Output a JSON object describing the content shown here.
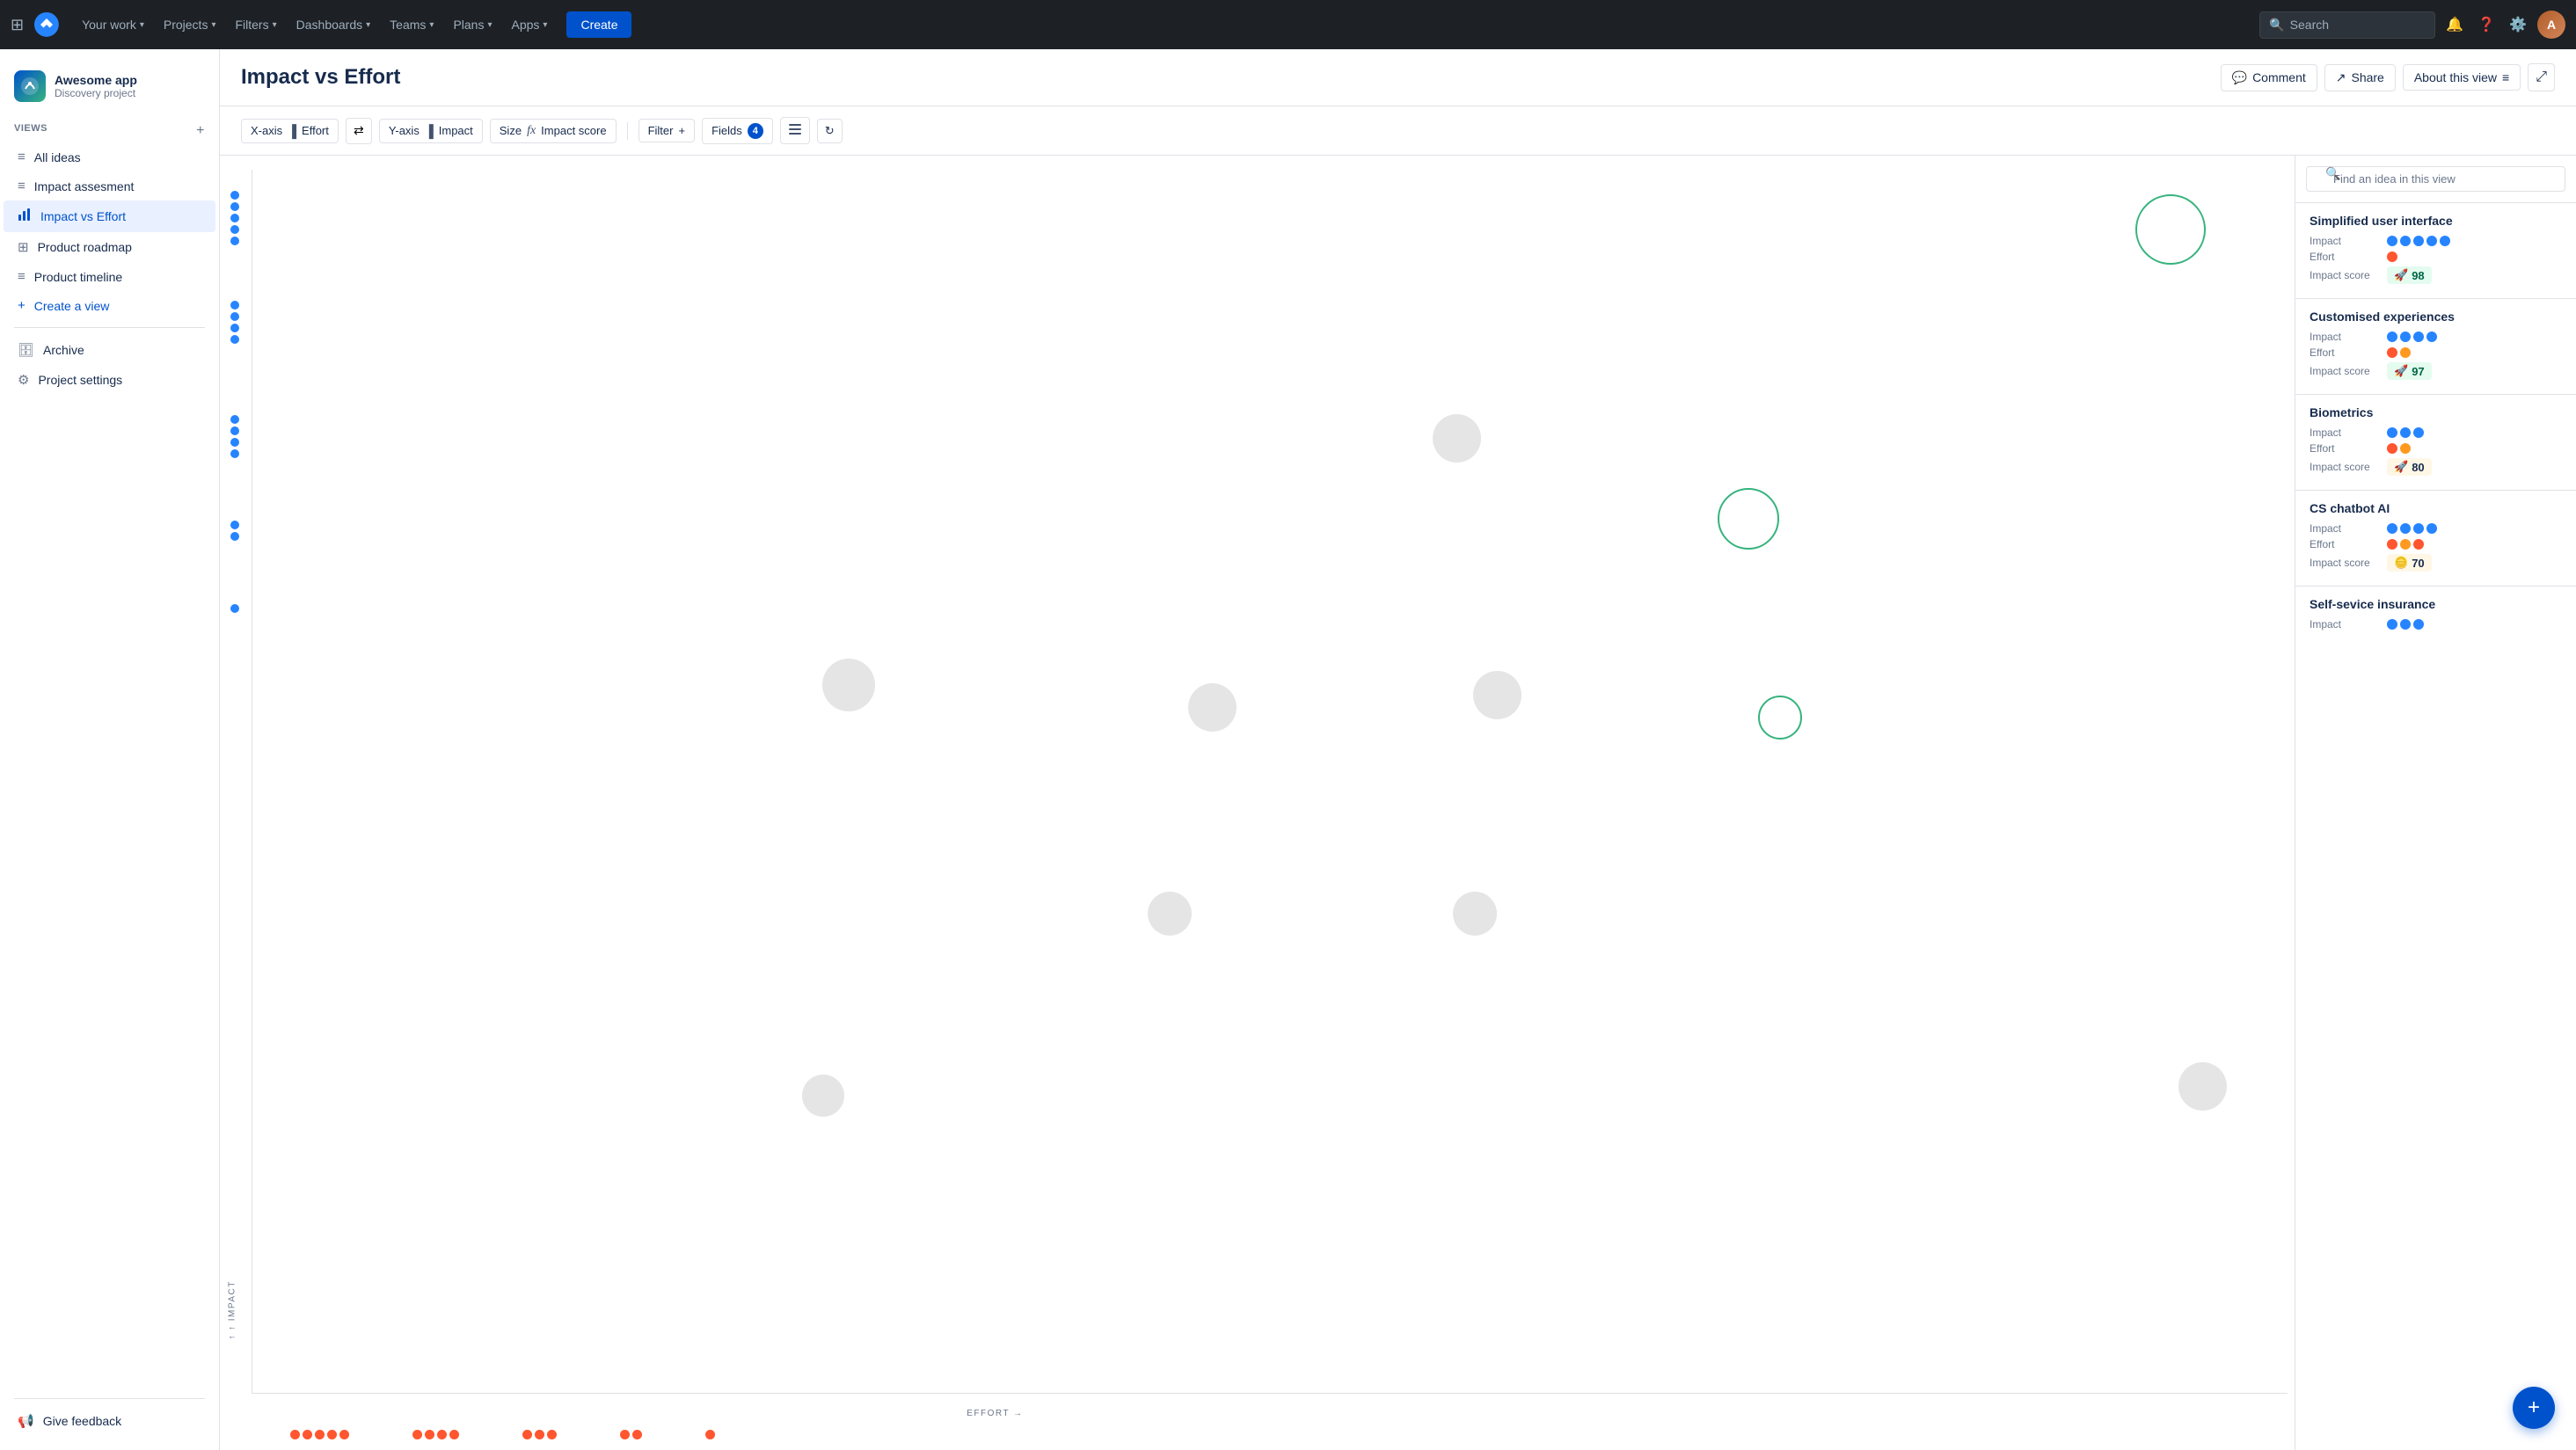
{
  "topnav": {
    "logo_text": "Jira",
    "nav_items": [
      {
        "label": "Your work",
        "has_dropdown": true,
        "active": false
      },
      {
        "label": "Projects",
        "has_dropdown": true,
        "active": false
      },
      {
        "label": "Filters",
        "has_dropdown": true,
        "active": false
      },
      {
        "label": "Dashboards",
        "has_dropdown": true,
        "active": false
      },
      {
        "label": "Teams",
        "has_dropdown": true,
        "active": false
      },
      {
        "label": "Plans",
        "has_dropdown": true,
        "active": false
      },
      {
        "label": "Apps",
        "has_dropdown": true,
        "active": false
      }
    ],
    "create_label": "Create",
    "search_placeholder": "Search"
  },
  "sidebar": {
    "project_name": "Awesome app",
    "project_sub": "Discovery project",
    "views_label": "VIEWS",
    "add_view_tooltip": "Add view",
    "items": [
      {
        "label": "All ideas",
        "icon": "list",
        "active": false
      },
      {
        "label": "Impact assesment",
        "icon": "list",
        "active": false
      },
      {
        "label": "Impact vs Effort",
        "icon": "chart",
        "active": true
      },
      {
        "label": "Product roadmap",
        "icon": "grid",
        "active": false
      },
      {
        "label": "Product timeline",
        "icon": "list",
        "active": false
      },
      {
        "label": "Create a view",
        "icon": "plus",
        "active": false,
        "create": true
      }
    ],
    "archive_label": "Archive",
    "settings_label": "Project settings",
    "feedback_label": "Give feedback"
  },
  "content": {
    "title": "Impact vs Effort",
    "header_buttons": [
      {
        "label": "Comment",
        "icon": "comment"
      },
      {
        "label": "Share",
        "icon": "share"
      },
      {
        "label": "About this view",
        "icon": "lines"
      }
    ],
    "expand_icon": "⤢"
  },
  "toolbar": {
    "xaxis_label": "X-axis",
    "xaxis_value": "Effort",
    "yaxis_label": "Y-axis",
    "yaxis_value": "Impact",
    "size_label": "Size",
    "size_value": "Impact score",
    "filter_label": "Filter",
    "fields_label": "Fields",
    "fields_count": "4"
  },
  "right_panel": {
    "search_placeholder": "Find an idea in this view",
    "ideas": [
      {
        "title": "Simplified user interface",
        "impact_dots": 5,
        "effort_dots": 1,
        "effort_color": "red",
        "score": 98,
        "score_type": "high"
      },
      {
        "title": "Customised experiences",
        "impact_dots": 4,
        "effort_dots": 2,
        "effort_color": "red-orange",
        "score": 97,
        "score_type": "high"
      },
      {
        "title": "Biometrics",
        "impact_dots": 3,
        "effort_dots": 2,
        "effort_color": "red-orange",
        "score": 80,
        "score_type": "medium"
      },
      {
        "title": "CS chatbot AI",
        "impact_dots": 4,
        "effort_dots": 3,
        "effort_color": "red-orange-red",
        "score": 70,
        "score_type": "medium"
      },
      {
        "title": "Self-sevice insurance",
        "impact_dots": 3,
        "effort_dots": 0,
        "score": null,
        "score_type": "none"
      }
    ]
  },
  "scatter": {
    "x_axis_label": "EFFORT →",
    "y_axis_label": "↑ IMPACT"
  }
}
